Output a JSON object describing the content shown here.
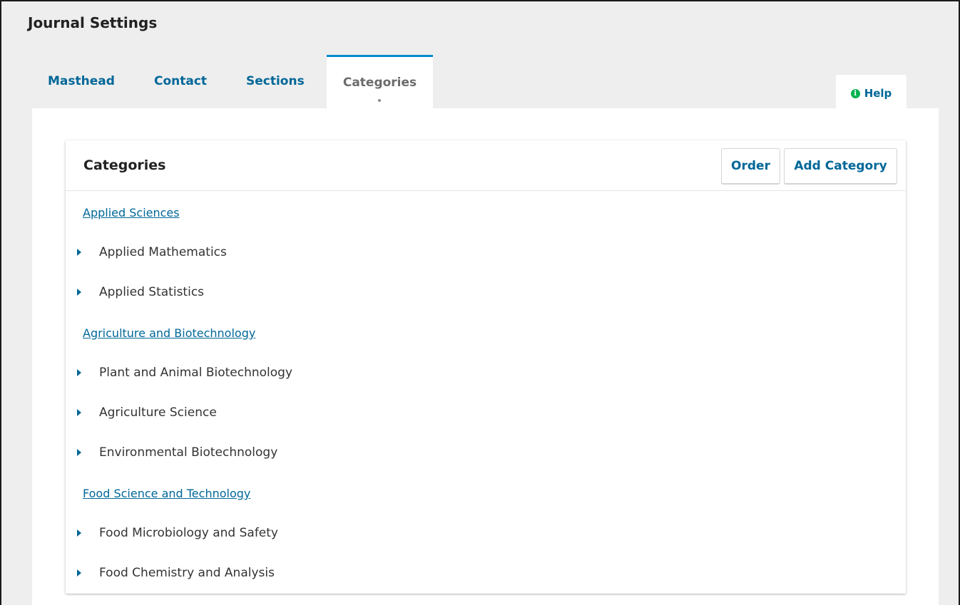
{
  "page": {
    "title": "Journal Settings"
  },
  "tabs": [
    "Masthead",
    "Contact",
    "Sections",
    "Categories"
  ],
  "help": {
    "label": "Help",
    "icon": "info-icon"
  },
  "panel": {
    "title": "Categories",
    "order_label": "Order",
    "add_label": "Add Category"
  },
  "categories": [
    {
      "name": "Applied Sciences",
      "children": [
        "Applied Mathematics",
        "Applied Statistics"
      ]
    },
    {
      "name": "Agriculture and Biotechnology",
      "children": [
        "Plant and Animal Biotechnology",
        "Agriculture Science",
        "Environmental Biotechnology"
      ]
    },
    {
      "name": "Food Science and Technology",
      "children": [
        "Food Microbiology and Safety",
        "Food Chemistry and Analysis"
      ]
    }
  ],
  "colors": {
    "link": "#006798",
    "active_tab_border": "#008acb",
    "help_icon": "#00b24e"
  }
}
